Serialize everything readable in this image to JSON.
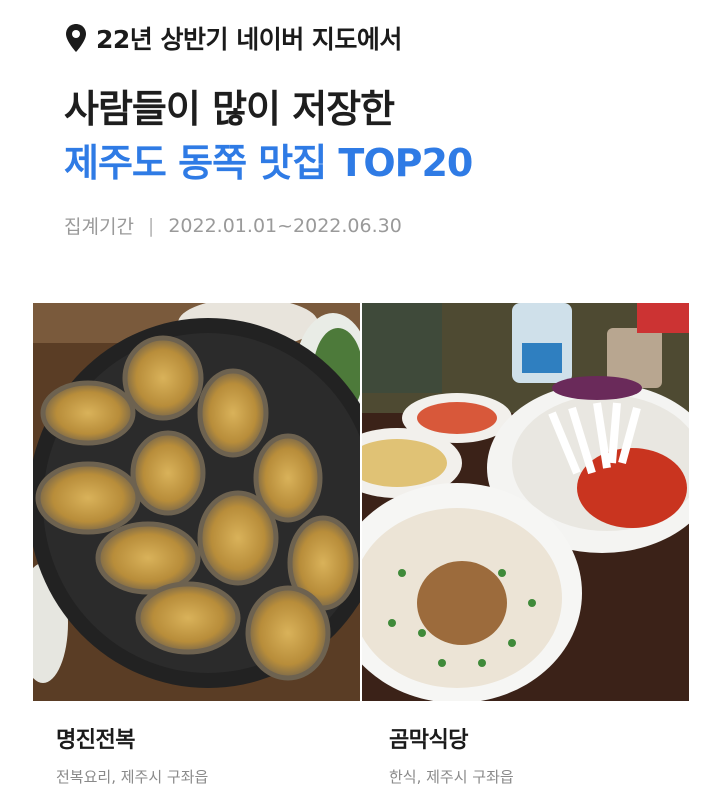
{
  "header": {
    "subtitle": "22년 상반기 네이버 지도에서",
    "title_line1": "사람들이 많이 저장한",
    "title_line2": "제주도 동쪽 맛집 TOP20",
    "period_label": "집계기간",
    "period_separator": "|",
    "period_value": "2022.01.01~2022.06.30"
  },
  "places": [
    {
      "name": "명진전복",
      "category": "전복요리, 제주시 구좌읍"
    },
    {
      "name": "곰막식당",
      "category": "한식, 제주시 구좌읍"
    }
  ],
  "colors": {
    "accent": "#2f7be5",
    "text": "#1b1b1b",
    "muted": "#9a9a9a"
  },
  "icons": {
    "location": "map-pin-icon"
  }
}
